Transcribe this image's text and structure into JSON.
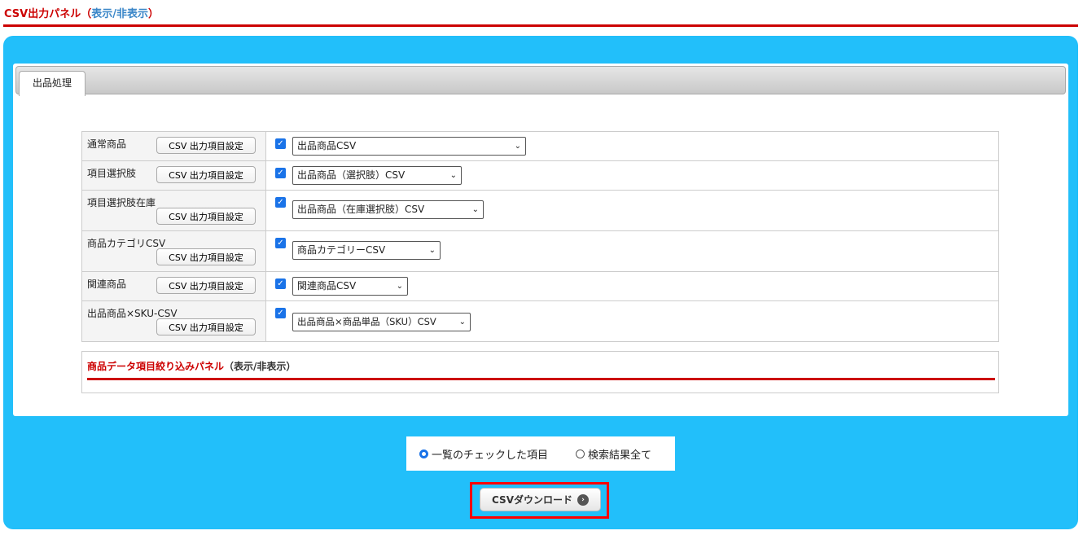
{
  "header": {
    "title": "CSV出力パネル",
    "paren_open": "（",
    "toggle": "表示/非表示",
    "paren_close": "）"
  },
  "tab": "出品処理",
  "rows": [
    {
      "label": "通常商品",
      "button": "CSV 出力項目設定",
      "checked": true,
      "select": "出品商品CSV"
    },
    {
      "label": "項目選択肢",
      "button": "CSV 出力項目設定",
      "checked": true,
      "select": "出品商品（選択肢）CSV"
    },
    {
      "label": "項目選択肢在庫",
      "button": "CSV 出力項目設定",
      "checked": true,
      "select": "出品商品（在庫選択肢）CSV"
    },
    {
      "label": "商品カテゴリCSV",
      "button": "CSV 出力項目設定",
      "checked": true,
      "select": "商品カテゴリーCSV"
    },
    {
      "label": "関連商品",
      "button": "CSV 出力項目設定",
      "checked": true,
      "select": "関連商品CSV"
    },
    {
      "label": "出品商品×SKU-CSV",
      "button": "CSV 出力項目設定",
      "checked": true,
      "select": "出品商品×商品単品（SKU）CSV"
    }
  ],
  "filter": {
    "title": "商品データ項目絞り込みパネル",
    "toggle": "（表示/非表示）"
  },
  "radios": {
    "option1": "一覧のチェックした項目",
    "option2": "検索結果全て",
    "selected": "option1"
  },
  "download": "CSVダウンロード"
}
